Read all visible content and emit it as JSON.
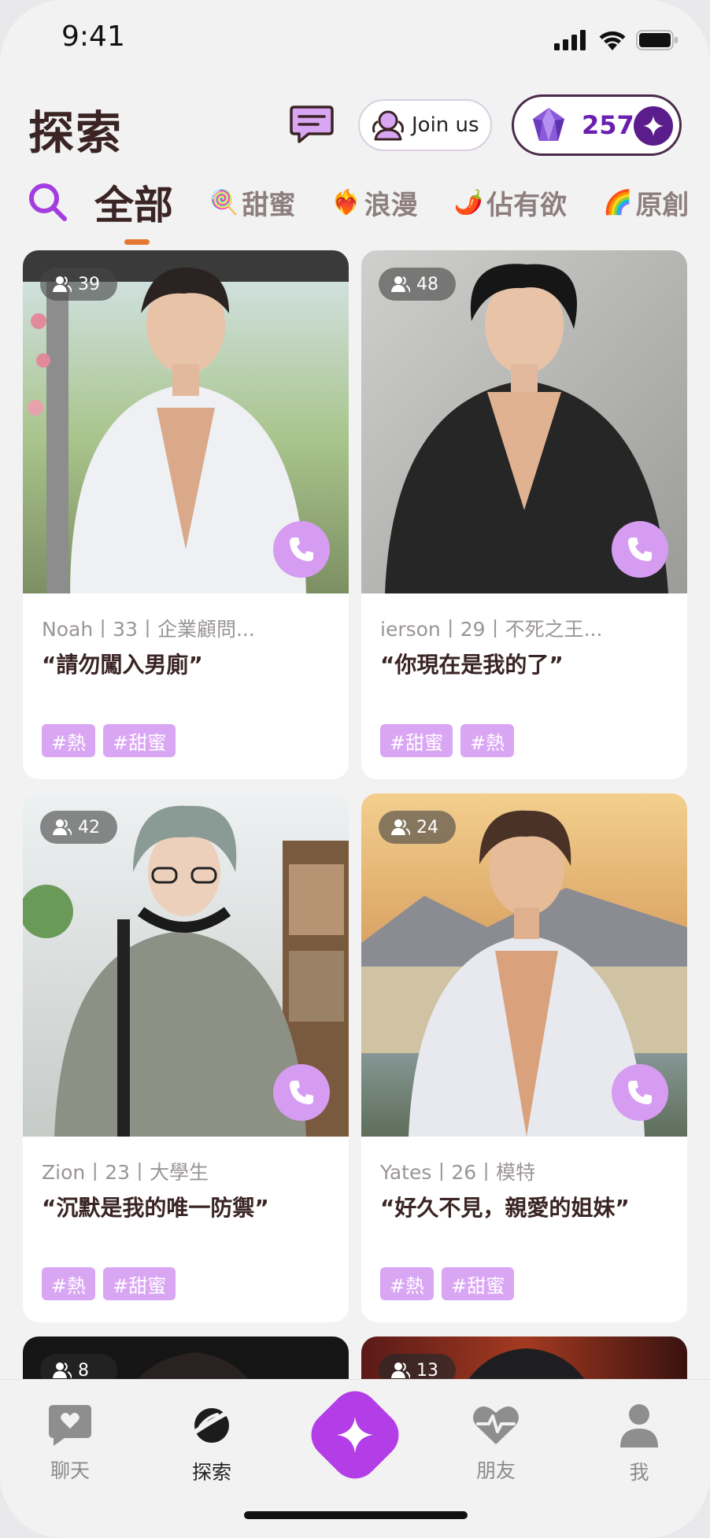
{
  "status_bar": {
    "time": "9:41"
  },
  "header": {
    "title": "探索",
    "join_label": "Join us",
    "coins": "257"
  },
  "tabs": [
    {
      "label": "全部",
      "emoji": "",
      "active": true
    },
    {
      "label": "甜蜜",
      "emoji": "🍭"
    },
    {
      "label": "浪漫",
      "emoji": "❤️‍🔥"
    },
    {
      "label": "佔有欲",
      "emoji": "🌶️"
    },
    {
      "label": "原創",
      "emoji": "🌈"
    }
  ],
  "cards": [
    {
      "viewers": "39",
      "meta": "Noah丨33丨企業顧問...",
      "quote": "“請勿闖入男廁”",
      "tags": [
        "#熱",
        "#甜蜜"
      ]
    },
    {
      "viewers": "48",
      "meta": "ierson丨29丨不死之王...",
      "quote": "“你現在是我的了”",
      "tags": [
        "#甜蜜",
        "#熱"
      ]
    },
    {
      "viewers": "42",
      "meta": "Zion丨23丨大學生",
      "quote": "“沉默是我的唯一防禦”",
      "tags": [
        "#熱",
        "#甜蜜"
      ]
    },
    {
      "viewers": "24",
      "meta": "Yates丨26丨模特",
      "quote": "“好久不見，親愛的姐妹”",
      "tags": [
        "#熱",
        "#甜蜜"
      ]
    },
    {
      "viewers": "8"
    },
    {
      "viewers": "13"
    }
  ],
  "bottom_nav": [
    {
      "label": "聊天",
      "icon": "chat-heart-icon"
    },
    {
      "label": "探索",
      "icon": "planet-icon",
      "active": true
    },
    {
      "label": "",
      "icon": "sparkle-icon"
    },
    {
      "label": "朋友",
      "icon": "heartbeat-icon"
    },
    {
      "label": "我",
      "icon": "person-icon"
    }
  ],
  "colors": {
    "accent": "#b33de6",
    "tag_bg": "#d9a6f4",
    "call_bg": "#d69cf2",
    "tab_underline": "#e47833"
  }
}
